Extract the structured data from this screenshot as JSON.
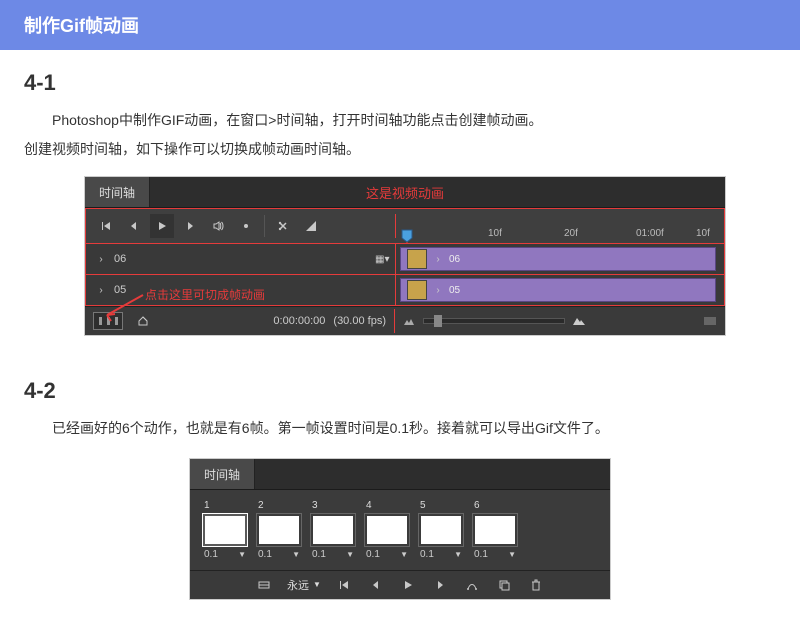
{
  "header": {
    "title": "制作Gif帧动画"
  },
  "s1": {
    "num": "4-1",
    "p1": "Photoshop中制作GIF动画，在窗口>时间轴，打开时间轴功能点击创建帧动画。",
    "p2": "创建视频时间轴，如下操作可以切换成帧动画时间轴。",
    "shot": {
      "tab": "时间轴",
      "anno_top": "这是视频动画",
      "ruler": {
        "t10f_a": "10f",
        "t20f": "20f",
        "t100f": "01:00f",
        "t10f_b": "10f"
      },
      "tracks": [
        {
          "name": "06",
          "clip": "06"
        },
        {
          "name": "05",
          "clip": "05"
        }
      ],
      "footer": {
        "switch_ann": "点击这里可切成帧动画",
        "timecode": "0:00:00:00",
        "fps": "(30.00 fps)"
      }
    }
  },
  "s2": {
    "num": "4-2",
    "p1": "已经画好的6个动作，也就是有6帧。第一帧设置时间是0.1秒。接着就可以导出Gif文件了。",
    "shot": {
      "tab": "时间轴",
      "frames": [
        {
          "n": "1",
          "dur": "0.1",
          "sel": true
        },
        {
          "n": "2",
          "dur": "0.1"
        },
        {
          "n": "3",
          "dur": "0.1"
        },
        {
          "n": "4",
          "dur": "0.1"
        },
        {
          "n": "5",
          "dur": "0.1"
        },
        {
          "n": "6",
          "dur": "0.1"
        }
      ],
      "loop": "永远"
    }
  }
}
